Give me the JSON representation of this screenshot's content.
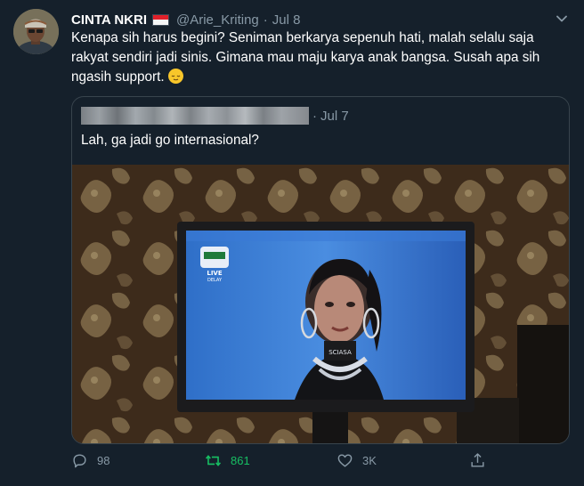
{
  "tweet": {
    "display_name": "CINTA NKRI",
    "handle": "@Arie_Kriting",
    "separator": "·",
    "date": "Jul 8",
    "text": "Kenapa sih harus begini? Seniman berkarya sepenuh hati, malah selalu saja rakyat sendiri jadi sinis. Gimana mau maju karya anak bangsa. Susah apa sih ngasih support."
  },
  "quoted": {
    "separator": "·",
    "date": "Jul 7",
    "text": "Lah, ga jadi go internasional?",
    "tv_logo_text": "LIVE",
    "tv_logo_sub": "DELAY",
    "shirt_text": "SCIASA"
  },
  "actions": {
    "reply_count": "98",
    "retweet_count": "861",
    "like_count": "3K"
  },
  "icons": {
    "flag": "indonesia-flag-icon",
    "emoji": "relieved-face-emoji",
    "menu": "chevron-down-icon",
    "reply": "reply-icon",
    "retweet": "retweet-icon",
    "like": "heart-icon",
    "share": "share-icon"
  },
  "colors": {
    "background": "#15202b",
    "muted": "#8899a6",
    "retweet_active": "#17bf63",
    "border": "#38444d"
  }
}
